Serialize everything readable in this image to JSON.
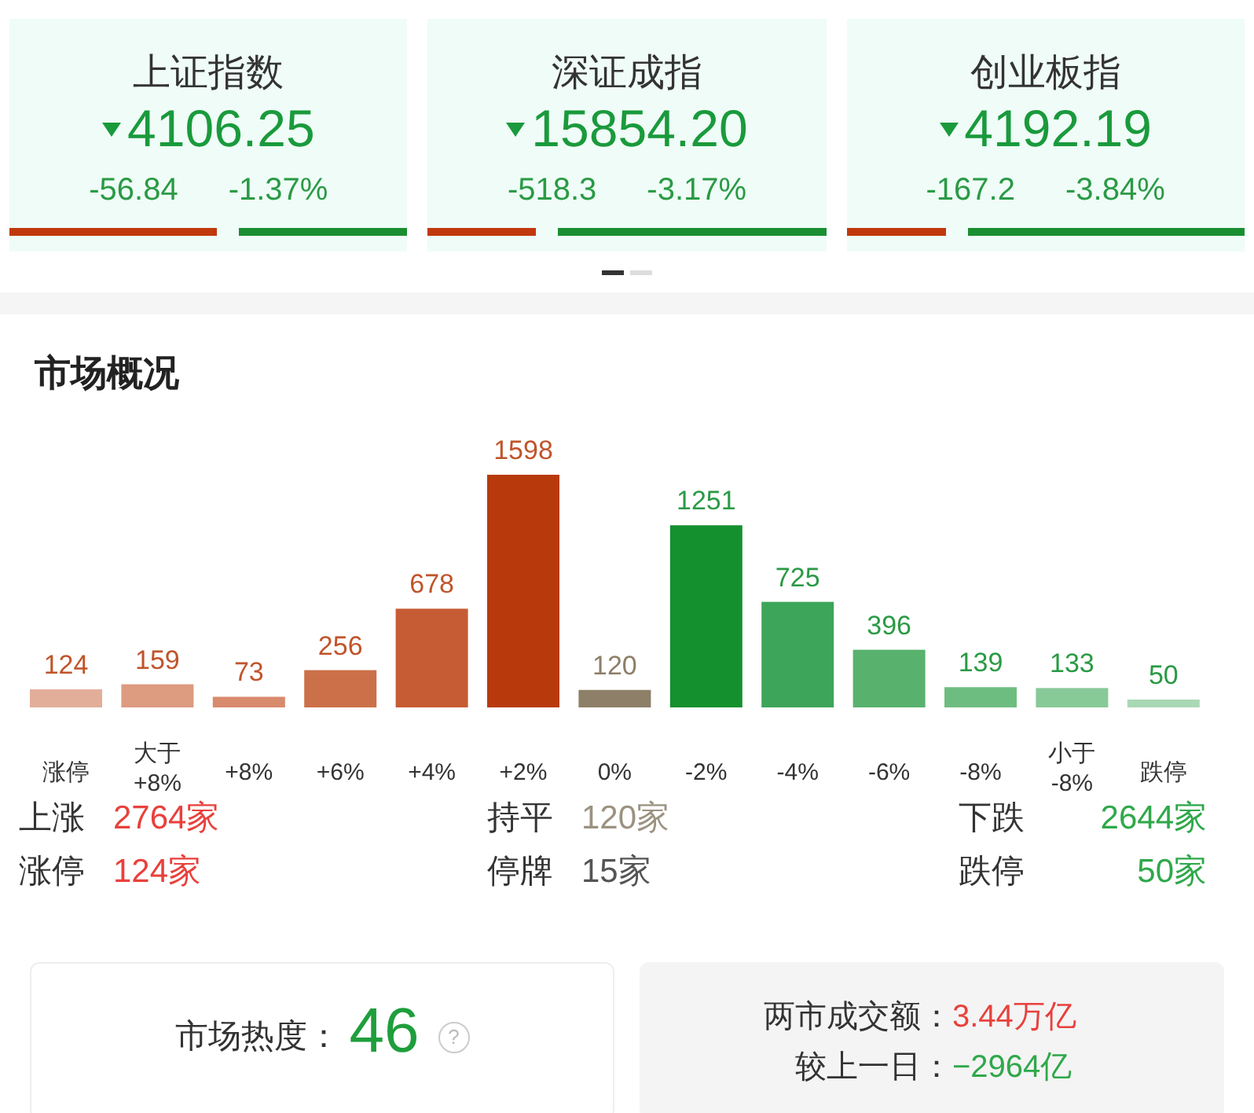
{
  "indices": [
    {
      "name": "上证指数",
      "down": true,
      "value": "4106.25",
      "change": "-56.84",
      "percent": "-1.37%",
      "level": 0.52
    },
    {
      "name": "深证成指",
      "down": true,
      "value": "15854.20",
      "change": "-518.3",
      "percent": "-3.17%",
      "level": 0.27
    },
    {
      "name": "创业板指",
      "down": true,
      "value": "4192.19",
      "change": "-167.2",
      "percent": "-3.84%",
      "level": 0.25
    }
  ],
  "pager": [
    {
      "selected": true
    },
    {
      "selected": false
    }
  ],
  "market": {
    "title": "市场概况",
    "chart": {
      "chart_data": {
        "type": "bar",
        "categories": [
          "涨停",
          "大于\n+8%",
          "+8%",
          "+6%",
          "+4%",
          "+2%",
          "0%",
          "-2%",
          "-4%",
          "-6%",
          "-8%",
          "小于\n-8%",
          "跌停"
        ],
        "values": [
          124,
          159,
          73,
          256,
          678,
          1598,
          120,
          1251,
          725,
          396,
          139,
          133,
          50
        ],
        "data_labels": true
      },
      "bars": [
        {
          "color": "#e2ae99"
        },
        {
          "color": "#dd9b80"
        },
        {
          "color": "#d88a6c"
        },
        {
          "color": "#cc7049"
        },
        {
          "color": "#c65c33"
        },
        {
          "color": "#b83a0c"
        },
        {
          "color": "#8d7f68"
        },
        {
          "color": "#14902e"
        },
        {
          "color": "#3da55a"
        },
        {
          "color": "#58b26d"
        },
        {
          "color": "#6ebd80"
        },
        {
          "color": "#88c998"
        },
        {
          "color": "#a9d8b4"
        }
      ]
    },
    "stats": [
      [
        {
          "label": "上涨",
          "value": "2764家",
          "color": "#e8413c"
        },
        {
          "label": "持平",
          "value": "120家",
          "color": "#9b9280"
        },
        {
          "label": "下跌",
          "value": "2644家",
          "color": "#2fa84a"
        }
      ],
      [
        {
          "label": "涨停",
          "value": "124家",
          "color": "#e8413c"
        },
        {
          "label": "停牌",
          "value": "15家",
          "color": "#555555"
        },
        {
          "label": "跌停",
          "value": "50家",
          "color": "#2fa84a"
        }
      ]
    ]
  },
  "heat": {
    "label": "市场热度：",
    "value": "46",
    "help": "?"
  },
  "turnover": [
    {
      "label": "两市成交额：",
      "value": "3.44万亿",
      "color": "#e8413c"
    },
    {
      "label": "较上一日：",
      "value": "−2964亿",
      "color": "#2fa84a"
    }
  ]
}
